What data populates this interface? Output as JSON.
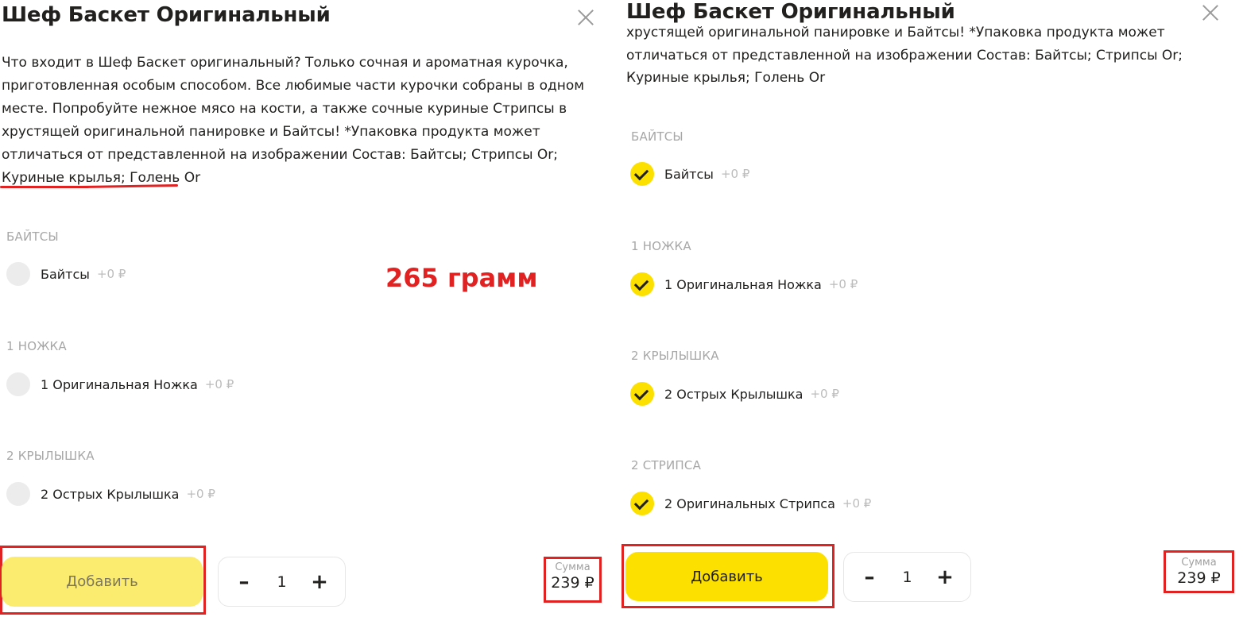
{
  "left": {
    "title": "Шеф Баскет Оригинальный",
    "description_lines": [
      "Что входит в Шеф Баскет оригинальный? Только сочная и ароматная курочка,",
      "приготовленная особым способом. Все любимые части курочки собраны в одном",
      "месте. Попробуйте нежное мясо на кости, а также сочные куриные Стрипсы в",
      "хрустящей оригинальной панировке и Байтсы! *Упаковка продукта может",
      "отличаться от представленной на изображении Состав: Байтсы; Стрипсы Or;",
      "Куриные крылья; Голень Or"
    ],
    "groups": [
      {
        "label": "БАЙТСЫ",
        "option": "Байтсы",
        "price": "+0 ₽",
        "checked": false
      },
      {
        "label": "1 НОЖКА",
        "option": "1 Оригинальная Ножка",
        "price": "+0 ₽",
        "checked": false
      },
      {
        "label": "2 КРЫЛЫШКА",
        "option": "2 Острых Крылышка",
        "price": "+0 ₽",
        "checked": false
      }
    ],
    "annotation_grams": "265 грамм",
    "add_button": "Добавить",
    "quantity": "1",
    "minus": "–",
    "plus": "+",
    "sum_label": "Сумма",
    "sum_value": "239 ₽"
  },
  "right": {
    "title": "Шеф Баскет Оригинальный",
    "description_lines": [
      "хрустящей оригинальной панировке и Байтсы! *Упаковка продукта может",
      "отличаться от представленной на изображении Состав: Байтсы; Стрипсы Or;",
      "Куриные крылья; Голень Or"
    ],
    "groups": [
      {
        "label": "БАЙТСЫ",
        "option": "Байтсы",
        "price": "+0 ₽",
        "checked": true
      },
      {
        "label": "1 НОЖКА",
        "option": "1 Оригинальная Ножка",
        "price": "+0 ₽",
        "checked": true
      },
      {
        "label": "2 КРЫЛЫШКА",
        "option": "2 Острых Крылышка",
        "price": "+0 ₽",
        "checked": true
      },
      {
        "label": "2 СТРИПСА",
        "option": "2 Оригинальных Стрипса",
        "price": "+0 ₽",
        "checked": true
      }
    ],
    "add_button": "Добавить",
    "quantity": "1",
    "minus": "–",
    "plus": "+",
    "sum_label": "Сумма",
    "sum_value": "239 ₽"
  },
  "colors": {
    "accent_yellow": "#fce000",
    "disabled_yellow": "#fbeb6e",
    "annotation_red": "#e02222",
    "muted_text": "#a7a7a7"
  }
}
